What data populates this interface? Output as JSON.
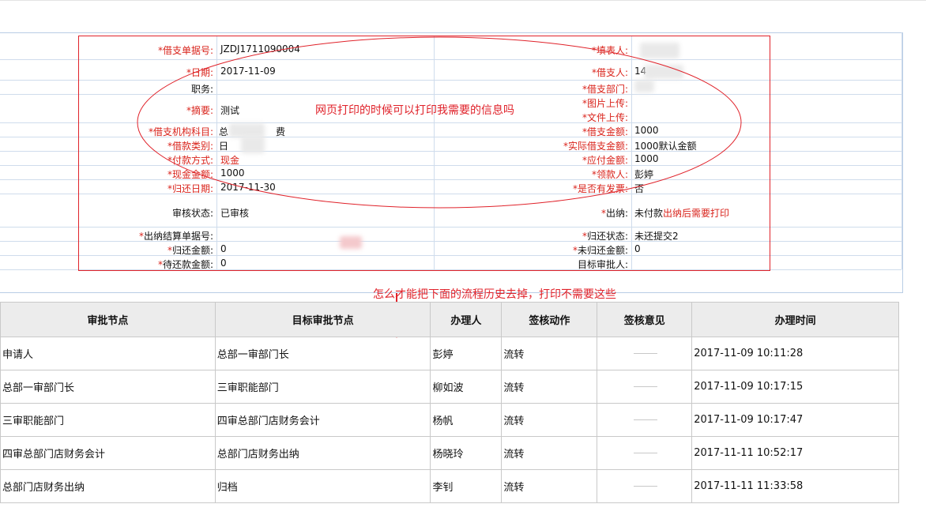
{
  "form": {
    "fields_left": [
      {
        "label": "借支单据号:",
        "required": true,
        "value": "JZDJ1711090004"
      },
      {
        "label": "日期:",
        "required": true,
        "value": "2017-11-09"
      },
      {
        "label": "职务:",
        "required": false,
        "value": ""
      },
      {
        "label": "摘要:",
        "required": true,
        "value": "测试"
      },
      {
        "label": "借支机构科目:",
        "required": true,
        "value": "总"
      },
      {
        "label": "借款类别:",
        "required": true,
        "value": "日"
      },
      {
        "label": "付款方式:",
        "required": true,
        "value": "现金"
      },
      {
        "label": "现金金额:",
        "required": true,
        "value": "1000"
      },
      {
        "label": "归还日期:",
        "required": true,
        "value": "2017-11-30"
      },
      {
        "label": "审核状态:",
        "required": false,
        "value": "已审核"
      },
      {
        "label": "出纳结算单据号:",
        "required": true,
        "value": ""
      },
      {
        "label": "归还金额:",
        "required": true,
        "value": "0"
      },
      {
        "label": "待还款金额:",
        "required": true,
        "value": "0"
      }
    ],
    "account_suffix": "费",
    "fields_right": [
      {
        "label": "填表人:",
        "required": true,
        "value": ""
      },
      {
        "label": "借支人:",
        "required": true,
        "value": "14"
      },
      {
        "label": "借支部门:",
        "required": true,
        "value": ""
      },
      {
        "label": "图片上传:",
        "required": true,
        "value": ""
      },
      {
        "label": "文件上传:",
        "required": true,
        "value": ""
      },
      {
        "label": "借支金额:",
        "required": true,
        "value": "1000"
      },
      {
        "label": "实际借支金额:",
        "required": true,
        "value": "1000默认金额"
      },
      {
        "label": "应付金额:",
        "required": true,
        "value": "1000"
      },
      {
        "label": "领款人:",
        "required": true,
        "value": "彭婷"
      },
      {
        "label": "是否有发票:",
        "required": true,
        "value": "否"
      },
      {
        "label": "出纳:",
        "required": true,
        "value": "未付款"
      },
      {
        "label": "归还状态:",
        "required": true,
        "value": "未还提交2"
      },
      {
        "label": "未归还金额:",
        "required": true,
        "value": "0"
      },
      {
        "label": "目标审批人:",
        "required": false,
        "value": ""
      }
    ],
    "cashier_note": "出纳后需要打印"
  },
  "annotations": {
    "print_question": "网页打印的时候可以打印我需要的信息吗",
    "remove_question": "怎么才能把下面的流程历史去掉，打印不需要这些"
  },
  "history": {
    "headers": [
      "审批节点",
      "目标审批节点",
      "办理人",
      "签核动作",
      "签核意见",
      "办理时间"
    ],
    "rows": [
      [
        "申请人",
        "总部一审部门长",
        "彭婷",
        "流转",
        "",
        "2017-11-09 10:11:28"
      ],
      [
        "总部一审部门长",
        "三审职能部门",
        "柳如波",
        "流转",
        "",
        "2017-11-09 10:17:15"
      ],
      [
        "三审职能部门",
        "四审总部门店财务会计",
        "杨帆",
        "流转",
        "",
        "2017-11-09 10:17:47"
      ],
      [
        "四审总部门店财务会计",
        "总部门店财务出纳",
        "杨晓玲",
        "流转",
        "",
        "2017-11-11 10:52:17"
      ],
      [
        "总部门店财务出纳",
        "归档",
        "李钊",
        "流转",
        "",
        "2017-11-11 11:33:58"
      ]
    ]
  },
  "colors": {
    "accent_red": "#e0222a",
    "grid_blue": "#cfdcec",
    "header_bg": "#ececec"
  }
}
